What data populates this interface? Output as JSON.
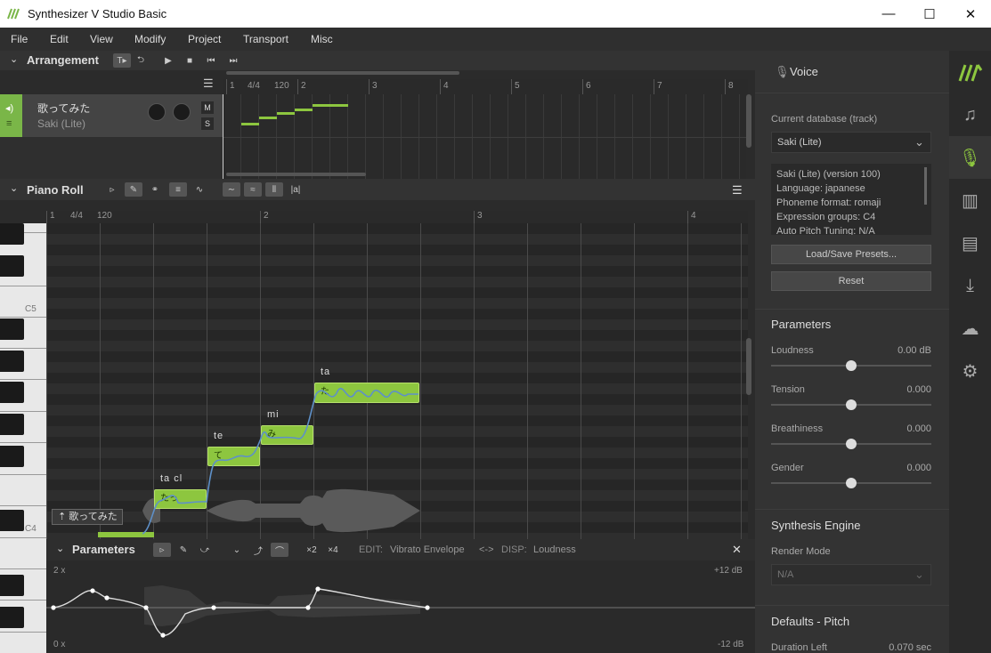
{
  "window": {
    "title": "Synthesizer V Studio Basic",
    "minimize": "—",
    "maximize": "☐",
    "close": "✕"
  },
  "menu": [
    "File",
    "Edit",
    "View",
    "Modify",
    "Project",
    "Transport",
    "Misc"
  ],
  "arrangement": {
    "label": "Arrangement",
    "ruler": {
      "time_sig": "4/4",
      "tempo": "120",
      "bars": [
        "1",
        "2",
        "3",
        "4",
        "5",
        "6",
        "7",
        "8"
      ]
    },
    "track": {
      "name": "歌ってみた",
      "voice": "Saki (Lite)",
      "mute": "M",
      "solo": "S"
    }
  },
  "piano_roll": {
    "label": "Piano Roll",
    "ruler": {
      "time_sig": "4/4",
      "tempo": "120",
      "bars": [
        "1",
        "2",
        "3",
        "4"
      ]
    },
    "keys": {
      "c5": "C5",
      "c4": "C4"
    },
    "track_tag": "歌ってみた",
    "notes": [
      {
        "lyric": "ta cl",
        "text": "たっ"
      },
      {
        "lyric": "te",
        "text": "て"
      },
      {
        "lyric": "mi",
        "text": "み"
      },
      {
        "lyric": "ta",
        "text": "た"
      }
    ],
    "tool_labels": {
      "ai": "|a|"
    }
  },
  "parameters": {
    "label": "Parameters",
    "mult_2": "×2",
    "mult_4": "×4",
    "edit_label": "EDIT:",
    "edit_value": "Vibrato Envelope",
    "arrows": "<->",
    "disp_label": "DISP:",
    "disp_value": "Loudness",
    "top_left": "2 x",
    "bottom_left": "0 x",
    "top_right": "+12 dB",
    "bottom_right": "-12 dB",
    "close": "✕"
  },
  "voice_panel": {
    "title": "Voice",
    "db_label": "Current database (track)",
    "db_value": "Saki (Lite)",
    "info": [
      "Saki (Lite) (version 100)",
      "Language: japanese",
      "Phoneme format: romaji",
      "Expression groups: C4",
      "Auto Pitch Tuning: N/A"
    ],
    "load_save": "Load/Save Presets...",
    "reset": "Reset",
    "params_title": "Parameters",
    "params": [
      {
        "name": "Loudness",
        "value": "0.00 dB",
        "level": 0.5
      },
      {
        "name": "Tension",
        "value": "0.000",
        "level": 0.5
      },
      {
        "name": "Breathiness",
        "value": "0.000",
        "level": 0.5
      },
      {
        "name": "Gender",
        "value": "0.000",
        "level": 0.5
      }
    ],
    "synth_title": "Synthesis Engine",
    "render_label": "Render Mode",
    "render_value": "N/A",
    "defaults_title": "Defaults - Pitch",
    "duration_label": "Duration Left",
    "duration_value": "0.070 sec"
  },
  "colors": {
    "accent": "#8dc63f",
    "background": "#2b2b2b"
  }
}
